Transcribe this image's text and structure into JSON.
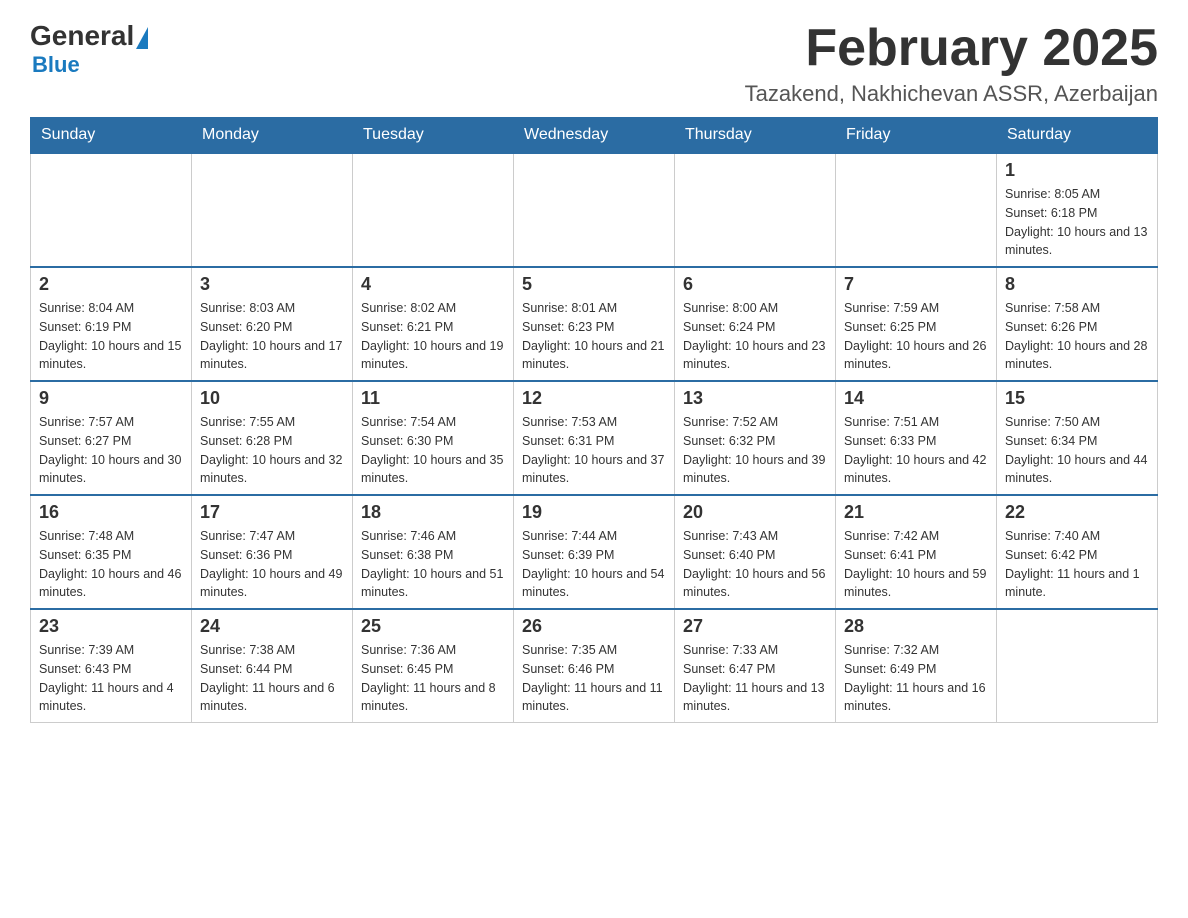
{
  "header": {
    "logo_general": "General",
    "logo_blue": "Blue",
    "month_title": "February 2025",
    "location": "Tazakend, Nakhichevan ASSR, Azerbaijan"
  },
  "days_of_week": [
    "Sunday",
    "Monday",
    "Tuesday",
    "Wednesday",
    "Thursday",
    "Friday",
    "Saturday"
  ],
  "weeks": [
    {
      "days": [
        {
          "num": "",
          "info": "",
          "empty": true
        },
        {
          "num": "",
          "info": "",
          "empty": true
        },
        {
          "num": "",
          "info": "",
          "empty": true
        },
        {
          "num": "",
          "info": "",
          "empty": true
        },
        {
          "num": "",
          "info": "",
          "empty": true
        },
        {
          "num": "",
          "info": "",
          "empty": true
        },
        {
          "num": "1",
          "info": "Sunrise: 8:05 AM\nSunset: 6:18 PM\nDaylight: 10 hours and 13 minutes.",
          "empty": false
        }
      ]
    },
    {
      "days": [
        {
          "num": "2",
          "info": "Sunrise: 8:04 AM\nSunset: 6:19 PM\nDaylight: 10 hours and 15 minutes.",
          "empty": false
        },
        {
          "num": "3",
          "info": "Sunrise: 8:03 AM\nSunset: 6:20 PM\nDaylight: 10 hours and 17 minutes.",
          "empty": false
        },
        {
          "num": "4",
          "info": "Sunrise: 8:02 AM\nSunset: 6:21 PM\nDaylight: 10 hours and 19 minutes.",
          "empty": false
        },
        {
          "num": "5",
          "info": "Sunrise: 8:01 AM\nSunset: 6:23 PM\nDaylight: 10 hours and 21 minutes.",
          "empty": false
        },
        {
          "num": "6",
          "info": "Sunrise: 8:00 AM\nSunset: 6:24 PM\nDaylight: 10 hours and 23 minutes.",
          "empty": false
        },
        {
          "num": "7",
          "info": "Sunrise: 7:59 AM\nSunset: 6:25 PM\nDaylight: 10 hours and 26 minutes.",
          "empty": false
        },
        {
          "num": "8",
          "info": "Sunrise: 7:58 AM\nSunset: 6:26 PM\nDaylight: 10 hours and 28 minutes.",
          "empty": false
        }
      ]
    },
    {
      "days": [
        {
          "num": "9",
          "info": "Sunrise: 7:57 AM\nSunset: 6:27 PM\nDaylight: 10 hours and 30 minutes.",
          "empty": false
        },
        {
          "num": "10",
          "info": "Sunrise: 7:55 AM\nSunset: 6:28 PM\nDaylight: 10 hours and 32 minutes.",
          "empty": false
        },
        {
          "num": "11",
          "info": "Sunrise: 7:54 AM\nSunset: 6:30 PM\nDaylight: 10 hours and 35 minutes.",
          "empty": false
        },
        {
          "num": "12",
          "info": "Sunrise: 7:53 AM\nSunset: 6:31 PM\nDaylight: 10 hours and 37 minutes.",
          "empty": false
        },
        {
          "num": "13",
          "info": "Sunrise: 7:52 AM\nSunset: 6:32 PM\nDaylight: 10 hours and 39 minutes.",
          "empty": false
        },
        {
          "num": "14",
          "info": "Sunrise: 7:51 AM\nSunset: 6:33 PM\nDaylight: 10 hours and 42 minutes.",
          "empty": false
        },
        {
          "num": "15",
          "info": "Sunrise: 7:50 AM\nSunset: 6:34 PM\nDaylight: 10 hours and 44 minutes.",
          "empty": false
        }
      ]
    },
    {
      "days": [
        {
          "num": "16",
          "info": "Sunrise: 7:48 AM\nSunset: 6:35 PM\nDaylight: 10 hours and 46 minutes.",
          "empty": false
        },
        {
          "num": "17",
          "info": "Sunrise: 7:47 AM\nSunset: 6:36 PM\nDaylight: 10 hours and 49 minutes.",
          "empty": false
        },
        {
          "num": "18",
          "info": "Sunrise: 7:46 AM\nSunset: 6:38 PM\nDaylight: 10 hours and 51 minutes.",
          "empty": false
        },
        {
          "num": "19",
          "info": "Sunrise: 7:44 AM\nSunset: 6:39 PM\nDaylight: 10 hours and 54 minutes.",
          "empty": false
        },
        {
          "num": "20",
          "info": "Sunrise: 7:43 AM\nSunset: 6:40 PM\nDaylight: 10 hours and 56 minutes.",
          "empty": false
        },
        {
          "num": "21",
          "info": "Sunrise: 7:42 AM\nSunset: 6:41 PM\nDaylight: 10 hours and 59 minutes.",
          "empty": false
        },
        {
          "num": "22",
          "info": "Sunrise: 7:40 AM\nSunset: 6:42 PM\nDaylight: 11 hours and 1 minute.",
          "empty": false
        }
      ]
    },
    {
      "days": [
        {
          "num": "23",
          "info": "Sunrise: 7:39 AM\nSunset: 6:43 PM\nDaylight: 11 hours and 4 minutes.",
          "empty": false
        },
        {
          "num": "24",
          "info": "Sunrise: 7:38 AM\nSunset: 6:44 PM\nDaylight: 11 hours and 6 minutes.",
          "empty": false
        },
        {
          "num": "25",
          "info": "Sunrise: 7:36 AM\nSunset: 6:45 PM\nDaylight: 11 hours and 8 minutes.",
          "empty": false
        },
        {
          "num": "26",
          "info": "Sunrise: 7:35 AM\nSunset: 6:46 PM\nDaylight: 11 hours and 11 minutes.",
          "empty": false
        },
        {
          "num": "27",
          "info": "Sunrise: 7:33 AM\nSunset: 6:47 PM\nDaylight: 11 hours and 13 minutes.",
          "empty": false
        },
        {
          "num": "28",
          "info": "Sunrise: 7:32 AM\nSunset: 6:49 PM\nDaylight: 11 hours and 16 minutes.",
          "empty": false
        },
        {
          "num": "",
          "info": "",
          "empty": true
        }
      ]
    }
  ]
}
